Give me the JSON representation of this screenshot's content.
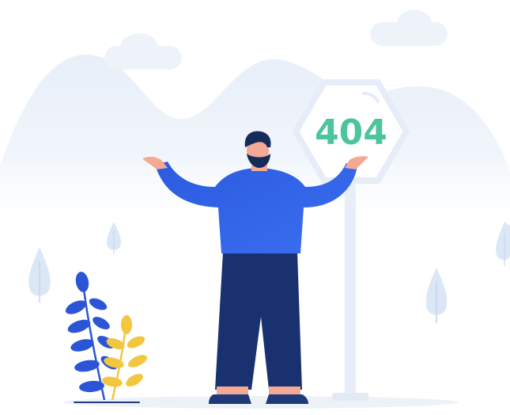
{
  "error_sign": {
    "code": "404"
  },
  "colors": {
    "background": "#ffffff",
    "hills": "#eef3fb",
    "clouds": "#f0f4fa",
    "sign_fill": "#ffffff",
    "sign_border": "#e6edf8",
    "sign_text": "#4cc59a",
    "sweater": "#2f62e6",
    "pants": "#1a3170",
    "skin": "#f4a994",
    "hair": "#152b5c",
    "shoe": "#1e3a78",
    "plant_blue": "#2c55d6",
    "plant_yellow": "#f2c63f",
    "tree": "#dde8f7"
  },
  "icons": {
    "person": "shrugging-person-illustration",
    "sign": "hexagon-signpost",
    "plants": "leafy-plant",
    "clouds": "cloud",
    "trees": "small-tree"
  }
}
